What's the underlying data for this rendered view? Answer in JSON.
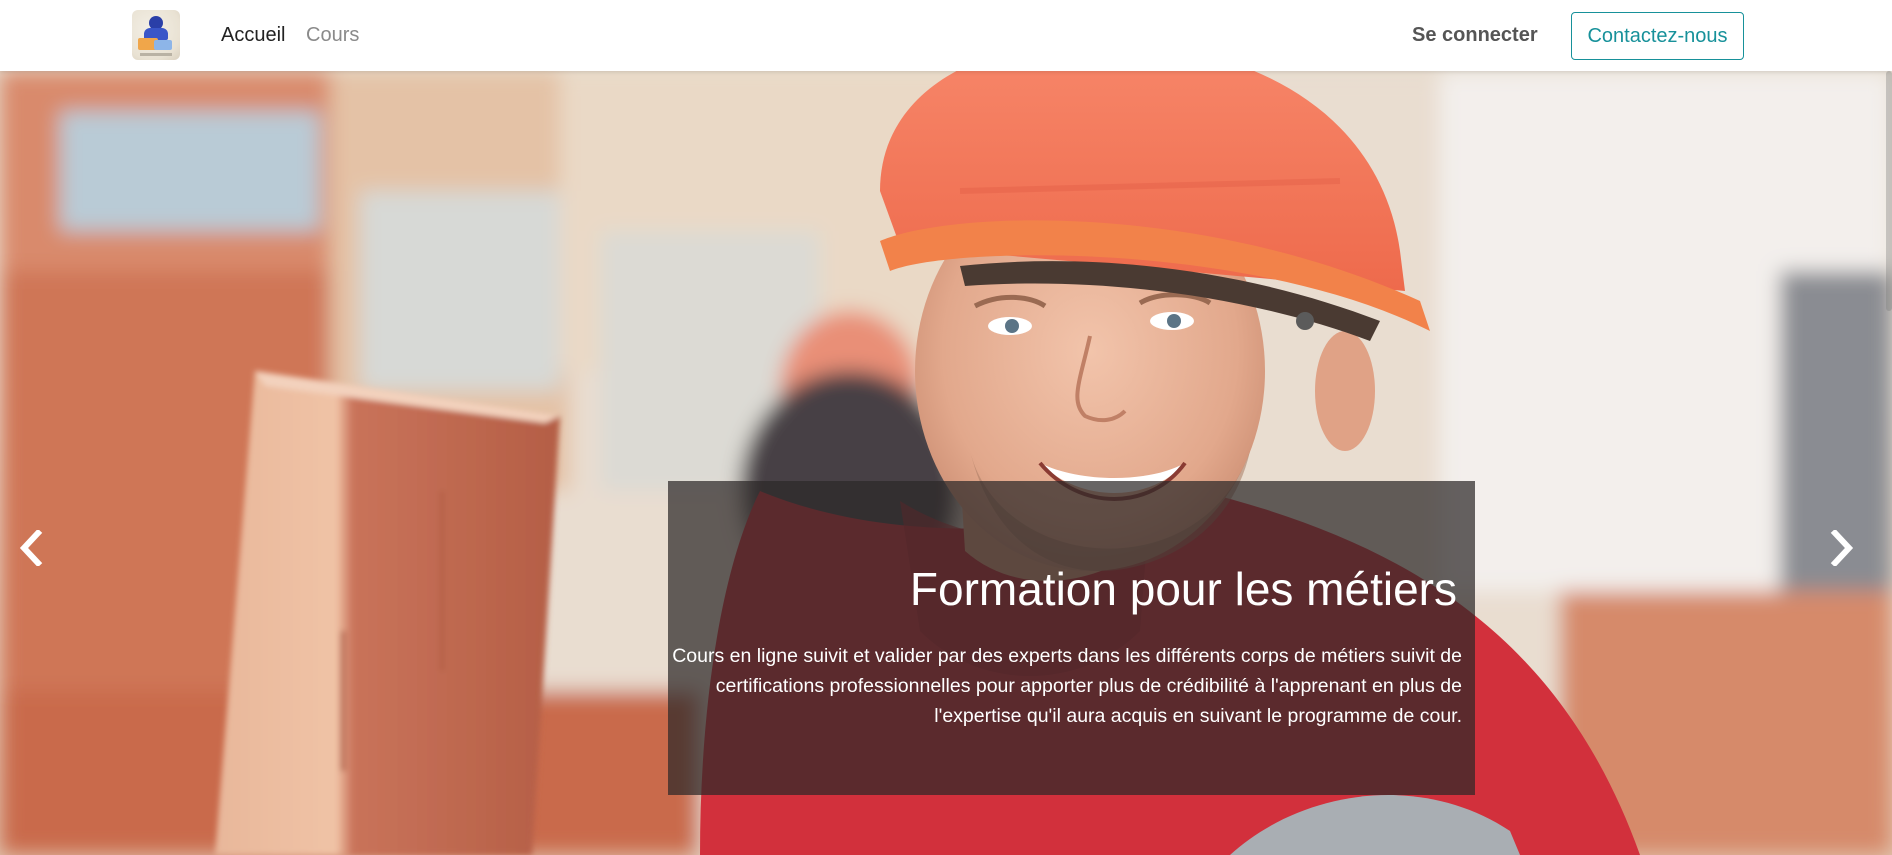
{
  "navbar": {
    "logo_icon": "mobile-learning-logo-icon",
    "links": [
      {
        "label": "Accueil",
        "active": true
      },
      {
        "label": "Cours",
        "active": false
      }
    ],
    "login_label": "Se connecter",
    "contact_label": "Contactez-nous",
    "accent_color": "#17919a"
  },
  "hero": {
    "title": "Formation pour les métiers",
    "description": "Cours en ligne suivit et valider par des experts dans les différents corps de métiers suivit de certifications professionnelles pour apporter plus de crédibilité à l'apprenant en plus de l'expertise qu'il aura acquis en suivant le programme de cour.",
    "prev_icon": "chevron-left-icon",
    "next_icon": "chevron-right-icon",
    "image_subject": "construction-worker-photo"
  }
}
